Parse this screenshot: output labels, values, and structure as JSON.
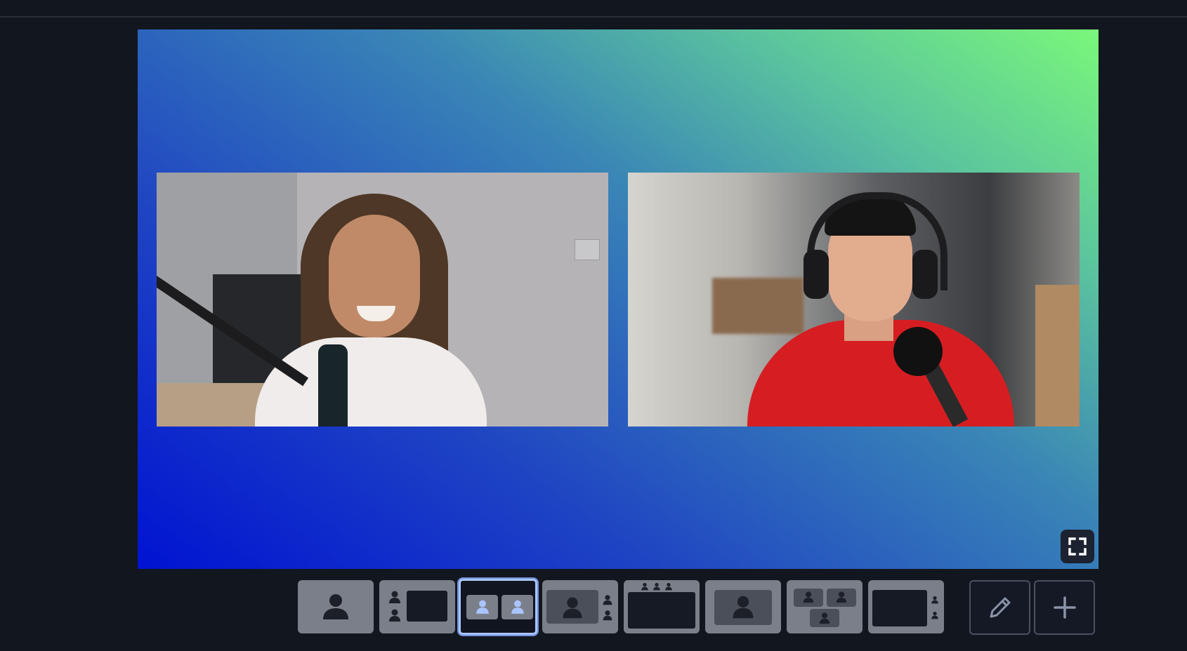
{
  "stage": {
    "background": {
      "from": "#0013d2",
      "to": "#7af77a"
    },
    "participants": [
      {
        "id": "participant-1"
      },
      {
        "id": "participant-2"
      }
    ]
  },
  "controls": {
    "fullscreen_icon": "fullscreen-icon",
    "edit_icon": "pencil-icon",
    "add_icon": "plus-icon"
  },
  "layouts": [
    {
      "id": "solo",
      "icon": "person-icon",
      "selected": false
    },
    {
      "id": "speaker-sidebar-left",
      "icon": "layout-sidebar-left-icon",
      "selected": false
    },
    {
      "id": "side-by-side",
      "icon": "layout-two-up-icon",
      "selected": true
    },
    {
      "id": "focus-with-thumbs-right",
      "icon": "layout-focus-right-icon",
      "selected": false
    },
    {
      "id": "thumbs-top",
      "icon": "layout-thumbs-top-icon",
      "selected": false
    },
    {
      "id": "focus-single",
      "icon": "layout-focus-icon",
      "selected": false
    },
    {
      "id": "grid-three",
      "icon": "layout-grid-icon",
      "selected": false
    },
    {
      "id": "screen-with-thumbs-right",
      "icon": "layout-screen-right-icon",
      "selected": false
    }
  ],
  "colors": {
    "app_bg": "#12161f",
    "selected_outline": "#a9c4ff",
    "layout_btn_bg": "#7b7f89"
  }
}
